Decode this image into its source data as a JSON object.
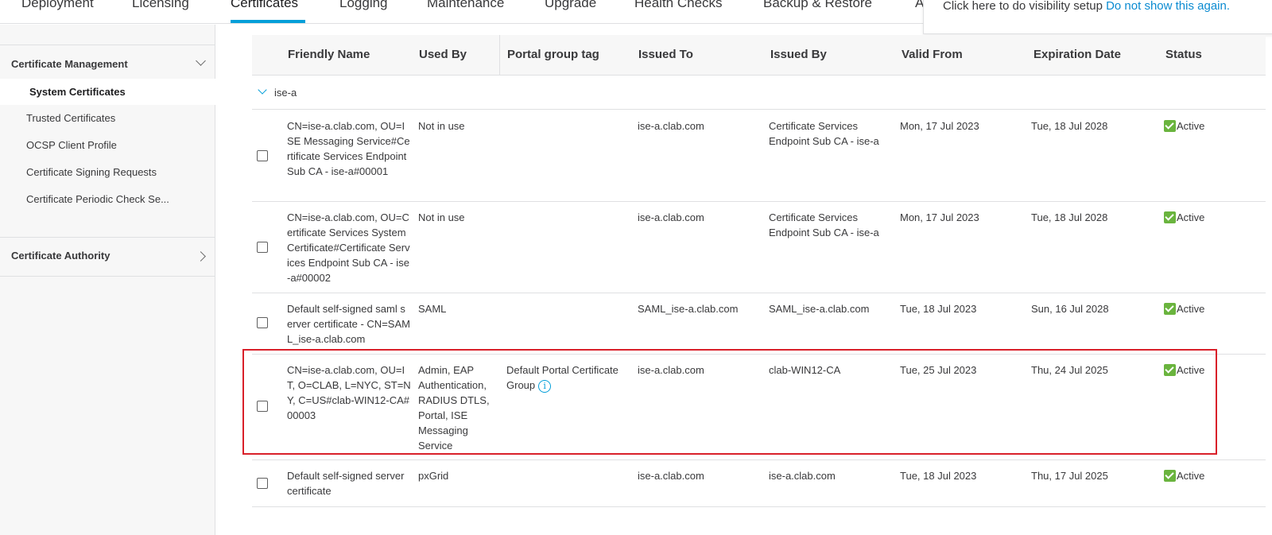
{
  "topnav": {
    "tabs": [
      {
        "label": "Deployment"
      },
      {
        "label": "Licensing"
      },
      {
        "label": "Certificates"
      },
      {
        "label": "Logging"
      },
      {
        "label": "Maintenance"
      },
      {
        "label": "Upgrade"
      },
      {
        "label": "Health Checks"
      },
      {
        "label": "Backup & Restore"
      },
      {
        "label": "A"
      }
    ],
    "active_tab": "Certificates"
  },
  "notice": {
    "text": "Click here to do visibility setup",
    "link": "Do not show this again."
  },
  "sidebar": {
    "sections": [
      {
        "title": "Certificate Management",
        "expanded": true,
        "items": [
          {
            "label": "System Certificates"
          },
          {
            "label": "Trusted Certificates"
          },
          {
            "label": "OCSP Client Profile"
          },
          {
            "label": "Certificate Signing Requests"
          },
          {
            "label": "Certificate Periodic Check Se..."
          }
        ]
      },
      {
        "title": "Certificate Authority",
        "expanded": false
      }
    ],
    "active_item": "System Certificates"
  },
  "table": {
    "columns": [
      "Friendly Name",
      "Used By",
      "Portal group tag",
      "Issued To",
      "Issued By",
      "Valid From",
      "Expiration Date",
      "Status"
    ],
    "group": "ise-a",
    "rows": [
      {
        "friendly_name": "CN=ise-a.clab.com, OU=ISE Messaging Service#Certificate Services Endpoint Sub CA - ise-a#00001",
        "used_by": "Not in use",
        "portal_group_tag": "",
        "issued_to": "ise-a.clab.com",
        "issued_by": "Certificate Services Endpoint Sub CA - ise-a",
        "valid_from": "Mon, 17 Jul 2023",
        "expiration_date": "Tue, 18 Jul 2028",
        "status": "Active"
      },
      {
        "friendly_name": "CN=ise-a.clab.com, OU=Certificate Services System Certificate#Certificate Services Endpoint Sub CA - ise-a#00002",
        "used_by": "Not in use",
        "portal_group_tag": "",
        "issued_to": "ise-a.clab.com",
        "issued_by": "Certificate Services Endpoint Sub CA - ise-a",
        "valid_from": "Mon, 17 Jul 2023",
        "expiration_date": "Tue, 18 Jul 2028",
        "status": "Active"
      },
      {
        "friendly_name": "Default self-signed saml server certificate - CN=SAML_ise-a.clab.com",
        "used_by": "SAML",
        "portal_group_tag": "",
        "issued_to": "SAML_ise-a.clab.com",
        "issued_by": "SAML_ise-a.clab.com",
        "valid_from": "Tue, 18 Jul 2023",
        "expiration_date": "Sun, 16 Jul 2028",
        "status": "Active"
      },
      {
        "friendly_name": "CN=ise-a.clab.com, OU=IT, O=CLAB, L=NYC, ST=NY, C=US#clab-WIN12-CA#00003",
        "used_by": "Admin, EAP Authentication, RADIUS DTLS, Portal, ISE Messaging Service",
        "portal_group_tag": "Default Portal Certificate Group",
        "issued_to": "ise-a.clab.com",
        "issued_by": "clab-WIN12-CA",
        "valid_from": "Tue, 25 Jul 2023",
        "expiration_date": "Thu, 24 Jul 2025",
        "status": "Active"
      },
      {
        "friendly_name": "Default self-signed server certificate",
        "used_by": "pxGrid",
        "portal_group_tag": "",
        "issued_to": "ise-a.clab.com",
        "issued_by": "ise-a.clab.com",
        "valid_from": "Tue, 18 Jul 2023",
        "expiration_date": "Thu, 17 Jul 2025",
        "status": "Active"
      }
    ],
    "info_icon_symbol": "i"
  },
  "colors": {
    "accent": "#049fd9",
    "active_check": "#6ab43e",
    "highlight_box": "#d9202a",
    "link": "#0b8bd1"
  }
}
